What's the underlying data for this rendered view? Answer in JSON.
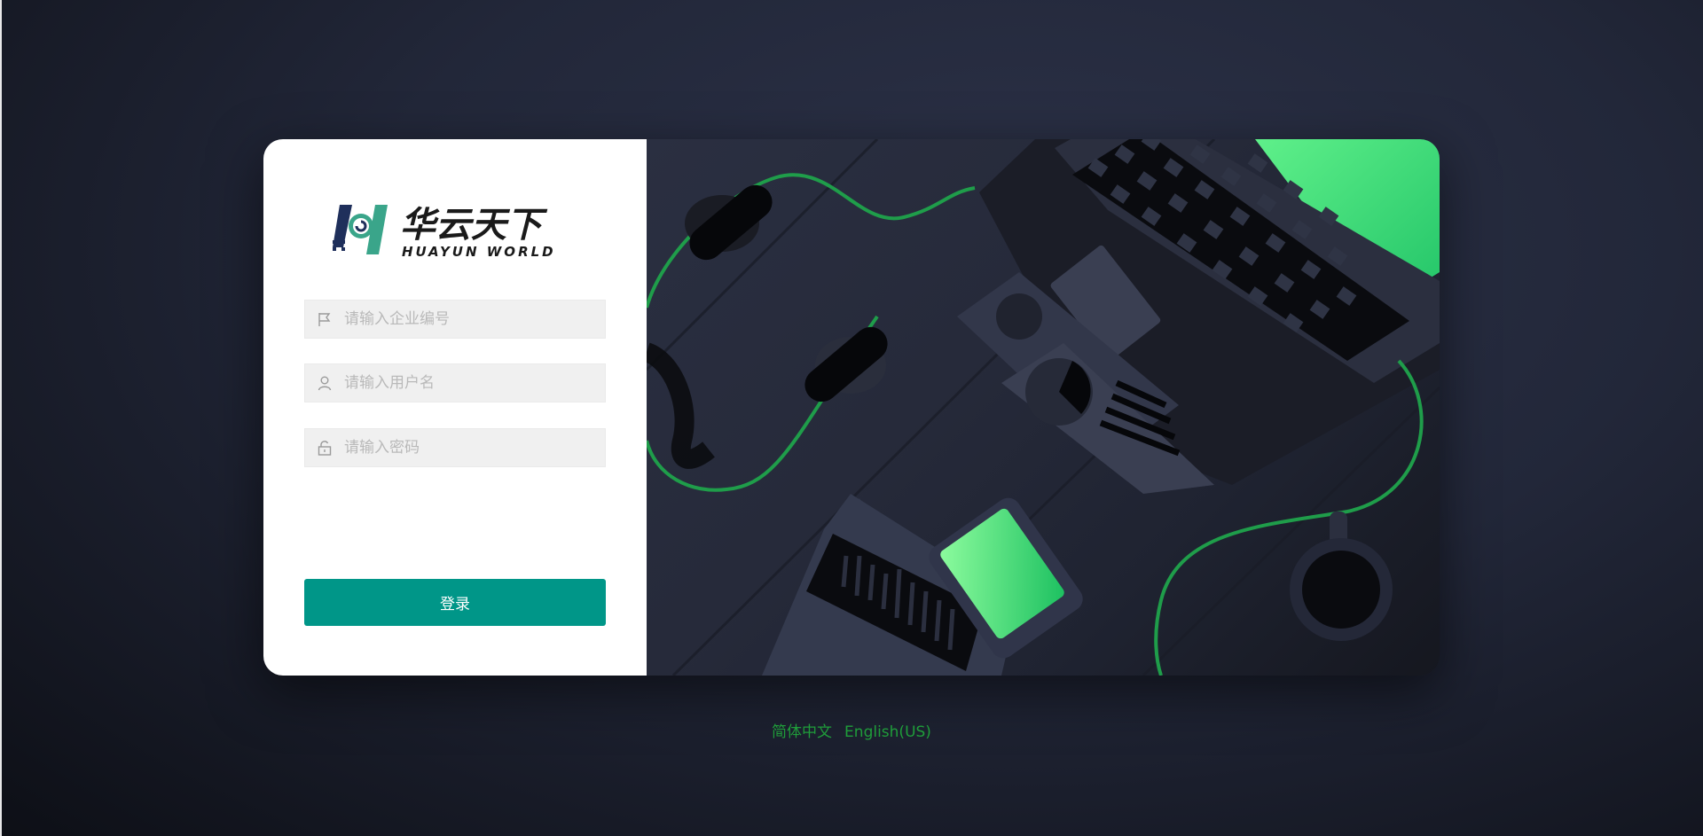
{
  "brand": {
    "logo_cn": "华云天下",
    "logo_en": "HUAYUN WORLD"
  },
  "form": {
    "company_placeholder": "请输入企业编号",
    "username_placeholder": "请输入用户名",
    "password_placeholder": "请输入密码",
    "login_label": "登录"
  },
  "language": {
    "options": [
      "简体中文",
      "English(US)"
    ]
  },
  "icons": {
    "company": "flag-icon",
    "username": "user-icon",
    "password": "lock-icon"
  },
  "colors": {
    "accent": "#009688",
    "language_link": "#1f9d3a",
    "illustration_green": "#2ecc71"
  }
}
